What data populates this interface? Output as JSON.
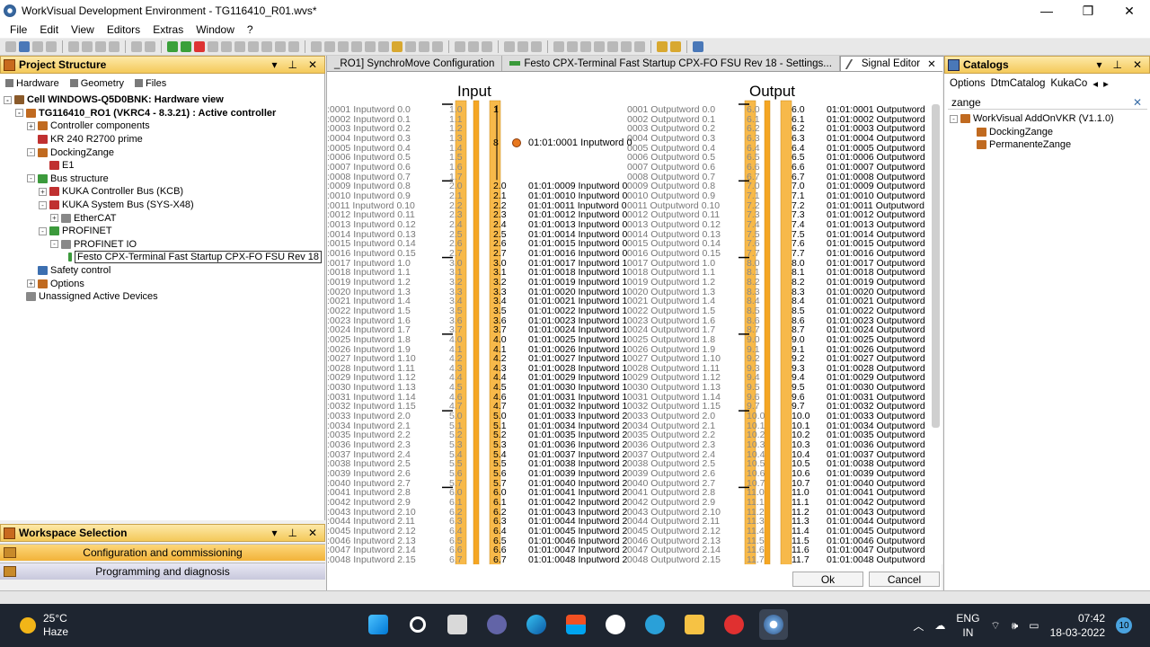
{
  "window": {
    "title": "WorkVisual Development Environment - TG116410_R01.wvs*",
    "minimize": "—",
    "restore": "❐",
    "close": "✕"
  },
  "menu": [
    "File",
    "Edit",
    "View",
    "Editors",
    "Extras",
    "Window",
    "?"
  ],
  "project_panel": {
    "title": "Project Structure",
    "tabs": [
      "Hardware",
      "Geometry",
      "Files"
    ],
    "tree": [
      {
        "level": 0,
        "label": "Cell WINDOWS-Q5D0BNK: Hardware view",
        "bold": true,
        "exp": "-",
        "icon": "cell"
      },
      {
        "level": 1,
        "label": "TG116410_RO1 (VKRC4 - 8.3.21) : Active controller",
        "bold": true,
        "exp": "-",
        "icon": "cpu"
      },
      {
        "level": 2,
        "label": "Controller components",
        "exp": "+",
        "icon": "cpu"
      },
      {
        "level": 2,
        "label": "KR 240 R2700 prime",
        "exp": "",
        "icon": "red"
      },
      {
        "level": 2,
        "label": "DockingZange",
        "exp": "-",
        "icon": "cpu"
      },
      {
        "level": 3,
        "label": "E1",
        "exp": "",
        "icon": "red"
      },
      {
        "level": 2,
        "label": "Bus structure",
        "exp": "-",
        "icon": "grn"
      },
      {
        "level": 3,
        "label": "KUKA Controller Bus (KCB)",
        "exp": "+",
        "icon": "red"
      },
      {
        "level": 3,
        "label": "KUKA System Bus (SYS-X48)",
        "exp": "-",
        "icon": "red"
      },
      {
        "level": 4,
        "label": "EtherCAT",
        "exp": "+",
        "icon": "gry"
      },
      {
        "level": 3,
        "label": "PROFINET",
        "exp": "-",
        "icon": "grn"
      },
      {
        "level": 4,
        "label": "PROFINET IO",
        "exp": "-",
        "icon": "gry"
      },
      {
        "level": 5,
        "label": "Festo CPX-Terminal Fast Startup CPX-FO FSU Rev 18",
        "exp": "",
        "icon": "grn",
        "selected": true
      },
      {
        "level": 2,
        "label": "Safety control",
        "exp": "",
        "icon": "blu"
      },
      {
        "level": 2,
        "label": "Options",
        "exp": "+",
        "icon": "cpu"
      },
      {
        "level": 1,
        "label": "Unassigned Active Devices",
        "exp": "",
        "icon": "gry"
      }
    ]
  },
  "workspace_panel": {
    "title": "Workspace Selection",
    "items": [
      {
        "label": "Configuration and commissioning",
        "active": true
      },
      {
        "label": "Programming and diagnosis",
        "active": false
      }
    ]
  },
  "editor": {
    "tabs": [
      {
        "label": "_RO1] SynchroMove Configuration",
        "active": false
      },
      {
        "label": "Festo CPX-Terminal Fast Startup CPX-FO FSU Rev 18 - Settings...",
        "active": false
      },
      {
        "label": "Signal Editor",
        "active": true
      }
    ],
    "close_label": "✕",
    "input_title": "Input",
    "output_title": "Output",
    "group_marker": "8",
    "group_bit": "1",
    "input_group_label": "01:01:0001 Inputword 0",
    "ok_label": "Ok",
    "cancel_label": "Cancel"
  },
  "catalog_panel": {
    "title": "Catalogs",
    "tabs": [
      "Options",
      "DtmCatalog",
      "KukaCo"
    ],
    "search_value": "zange",
    "clear_icon": "✕",
    "tree": [
      {
        "label": "WorkVisual AddOnVKR (V1.1.0)",
        "level": 0,
        "exp": "-"
      },
      {
        "label": "DockingZange",
        "level": 1,
        "exp": ""
      },
      {
        "label": "PermanenteZange",
        "level": 1,
        "exp": ""
      }
    ]
  },
  "taskbar": {
    "temperature": "25°C",
    "weather": "Haze",
    "language": "ENG",
    "region": "IN",
    "time": "07:42",
    "date": "18-03-2022",
    "notifications": "10"
  },
  "colors": {
    "accent": "#f5a623",
    "panel_header": "#f4c95a",
    "taskbar": "#1e2530"
  }
}
